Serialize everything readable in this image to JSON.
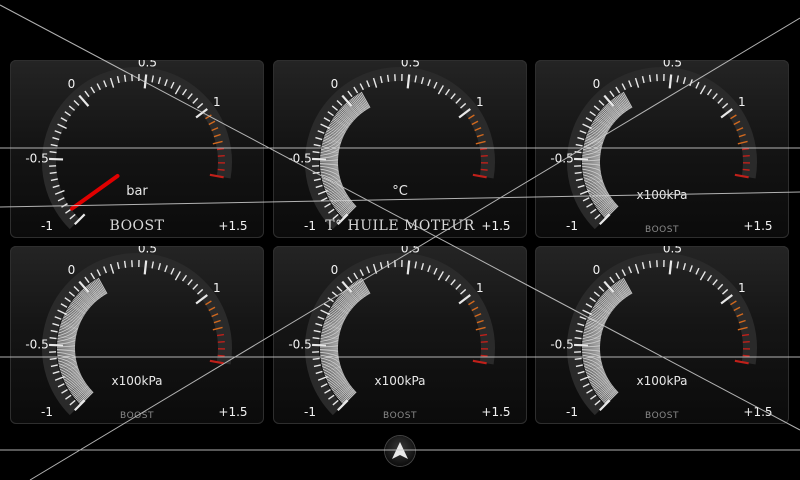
{
  "gauges": [
    {
      "unit": "bar",
      "label": "BOOST",
      "label_style": "big",
      "tick_labels": [
        "-1",
        "-0.5",
        "0",
        "0.5",
        "1",
        "+1.5"
      ],
      "needle_value": -0.9,
      "fill_to": null
    },
    {
      "unit": "°C",
      "label": "T° HUILE MOTEUR",
      "label_style": "big",
      "tick_labels": [
        "-1",
        "-0.5",
        "0",
        "0.5",
        "1",
        "+1.5"
      ],
      "needle_value": null,
      "fill_to": 0.13
    },
    {
      "unit": "x100kPa",
      "label": "BOOST",
      "label_style": "small",
      "tick_labels": [
        "-1",
        "-0.5",
        "0",
        "0.5",
        "1",
        "+1.5"
      ],
      "needle_value": null,
      "fill_to": 0.13
    },
    {
      "unit": "x100kPa",
      "label": "BOOST",
      "label_style": "small",
      "tick_labels": [
        "-1",
        "-0.5",
        "0",
        "0.5",
        "1",
        "+1.5"
      ],
      "needle_value": null,
      "fill_to": 0.13
    },
    {
      "unit": "x100kPa",
      "label": "BOOST",
      "label_style": "small",
      "tick_labels": [
        "-1",
        "-0.5",
        "0",
        "0.5",
        "1",
        "+1.5"
      ],
      "needle_value": null,
      "fill_to": 0.13
    },
    {
      "unit": "x100kPa",
      "label": "BOOST",
      "label_style": "small",
      "tick_labels": [
        "-1",
        "-0.5",
        "0",
        "0.5",
        "1",
        "+1.5"
      ],
      "needle_value": null,
      "fill_to": 0.13
    }
  ],
  "colors": {
    "needle": "#e00000",
    "fill": "#d8d8d8",
    "redline": "#c0201a",
    "orange": "#d2691e"
  },
  "icons": {
    "nav": "arrow-up-icon"
  }
}
